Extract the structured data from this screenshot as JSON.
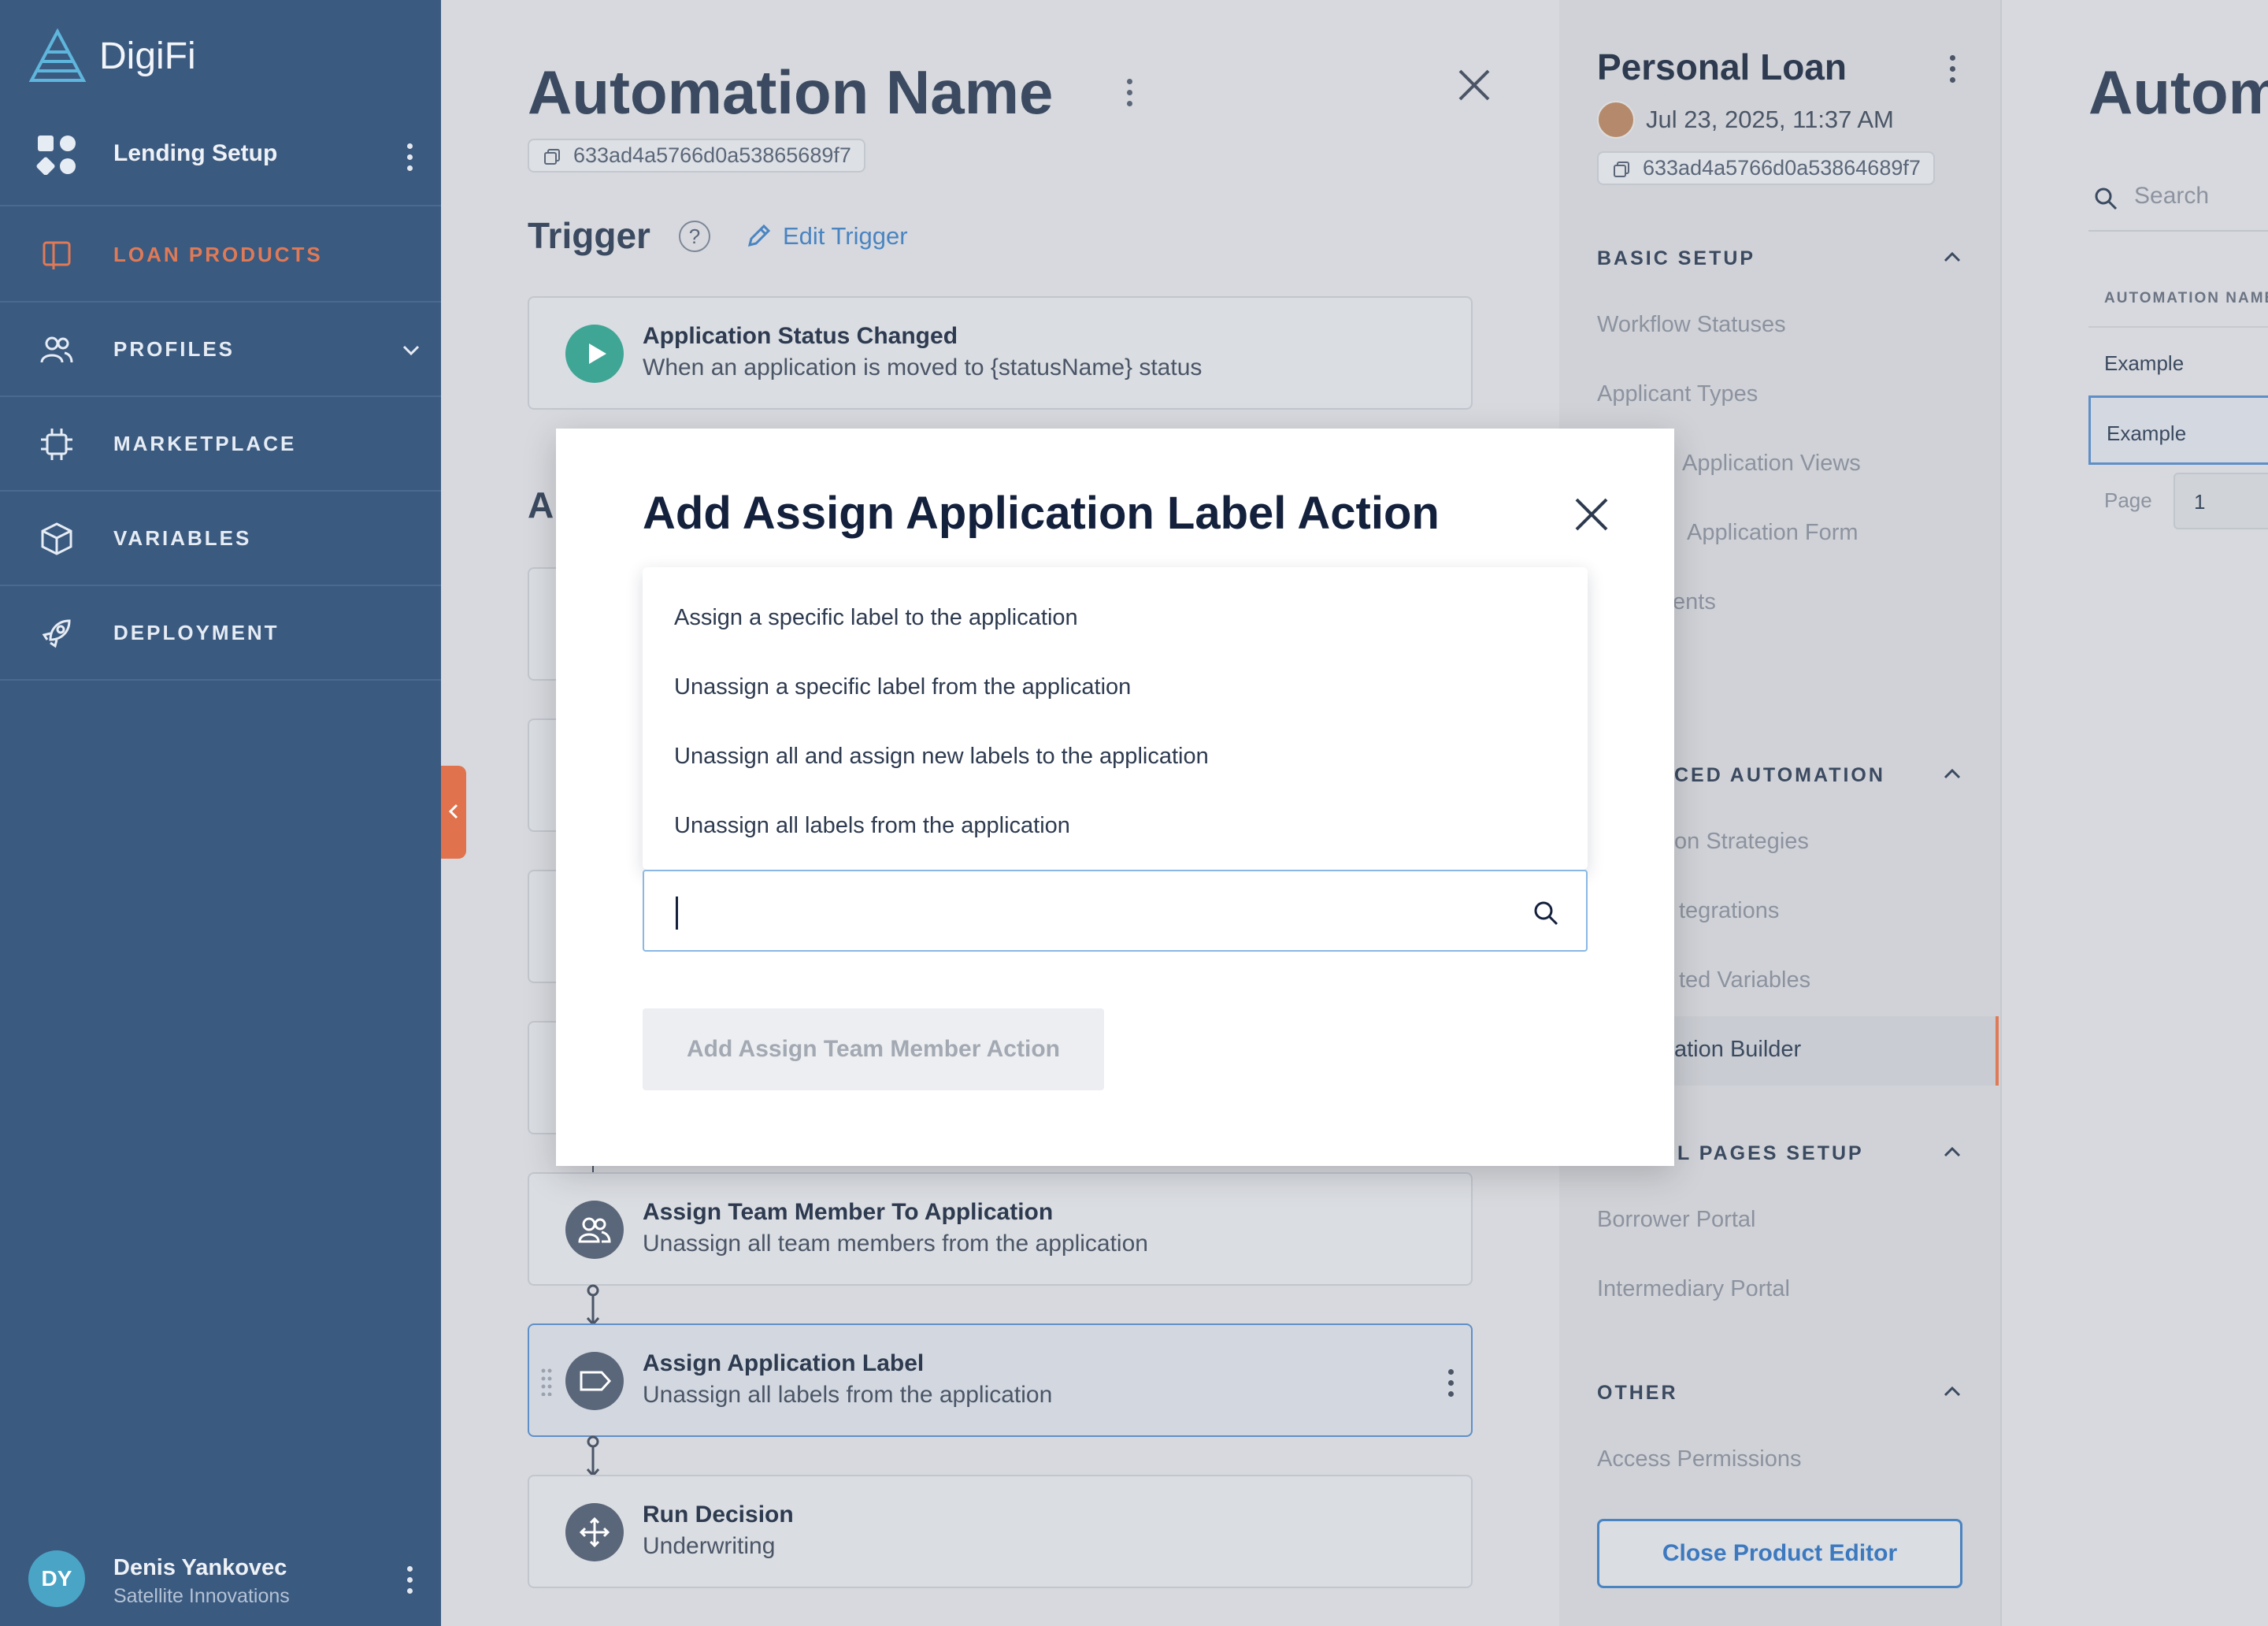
{
  "sidebar": {
    "brand": "DigiFi",
    "section": "Lending Setup",
    "nav": [
      {
        "label": "LOAN PRODUCTS",
        "icon": "book-icon",
        "active": true
      },
      {
        "label": "PROFILES",
        "icon": "people-icon"
      },
      {
        "label": "MARKETPLACE",
        "icon": "chip-icon"
      },
      {
        "label": "VARIABLES",
        "icon": "cube-icon"
      },
      {
        "label": "DEPLOYMENT",
        "icon": "rocket-icon"
      }
    ],
    "user": {
      "initials": "DY",
      "name": "Denis Yankovec",
      "org": "Satellite Innovations"
    }
  },
  "main": {
    "title": "Automation Name",
    "id": "633ad4a5766d0a53865689f7",
    "trigger_heading": "Trigger",
    "help": "?",
    "edit_trigger": "Edit Trigger",
    "ghost_heading": "A",
    "trigger_card": {
      "title": "Application Status Changed",
      "subtitle": "When an application is moved to {statusName} status"
    },
    "actions": [
      {
        "title": "Assign Team Member To Application",
        "subtitle": "Unassign all team members from the application"
      },
      {
        "title": "Assign Application Label",
        "subtitle": "Unassign all labels from the application",
        "selected": true
      },
      {
        "title": "Run Decision",
        "subtitle": "Underwriting"
      }
    ]
  },
  "product_panel": {
    "title": "Personal Loan",
    "date": "Jul 23, 2025, 11:37 AM",
    "id": "633ad4a5766d0a53864689f7",
    "sections": [
      {
        "heading": "BASIC SETUP",
        "items": [
          "Workflow Statuses",
          "Applicant Types",
          "Application Views",
          "Application Form",
          "ents"
        ]
      },
      {
        "heading": "CED AUTOMATION",
        "items": [
          "on Strategies",
          "tegrations",
          "ted Variables",
          "ation Builder"
        ]
      },
      {
        "heading": "L PAGES SETUP",
        "items": [
          "Borrower Portal",
          "Intermediary Portal"
        ]
      },
      {
        "heading": "OTHER",
        "items": [
          "Access Permissions"
        ]
      }
    ],
    "close_button": "Close Product Editor"
  },
  "automation_list": {
    "title": "Autom",
    "search_placeholder": "Search",
    "column": "AUTOMATION NAME",
    "rows": [
      "Example",
      "Example"
    ],
    "page_label": "Page",
    "page_value": "1"
  },
  "modal": {
    "title": "Add Assign Application Label Action",
    "options": [
      "Assign a specific label to the application",
      "Unassign a specific label from the application",
      "Unassign all and assign new labels to the application",
      "Unassign all labels from the application"
    ],
    "search_value": "",
    "add_button": "Add Assign Team Member Action"
  },
  "colors": {
    "sidebar": "#3b5a80",
    "accent": "#e07a56",
    "link": "#4a84c1",
    "teal": "#3fa595"
  }
}
